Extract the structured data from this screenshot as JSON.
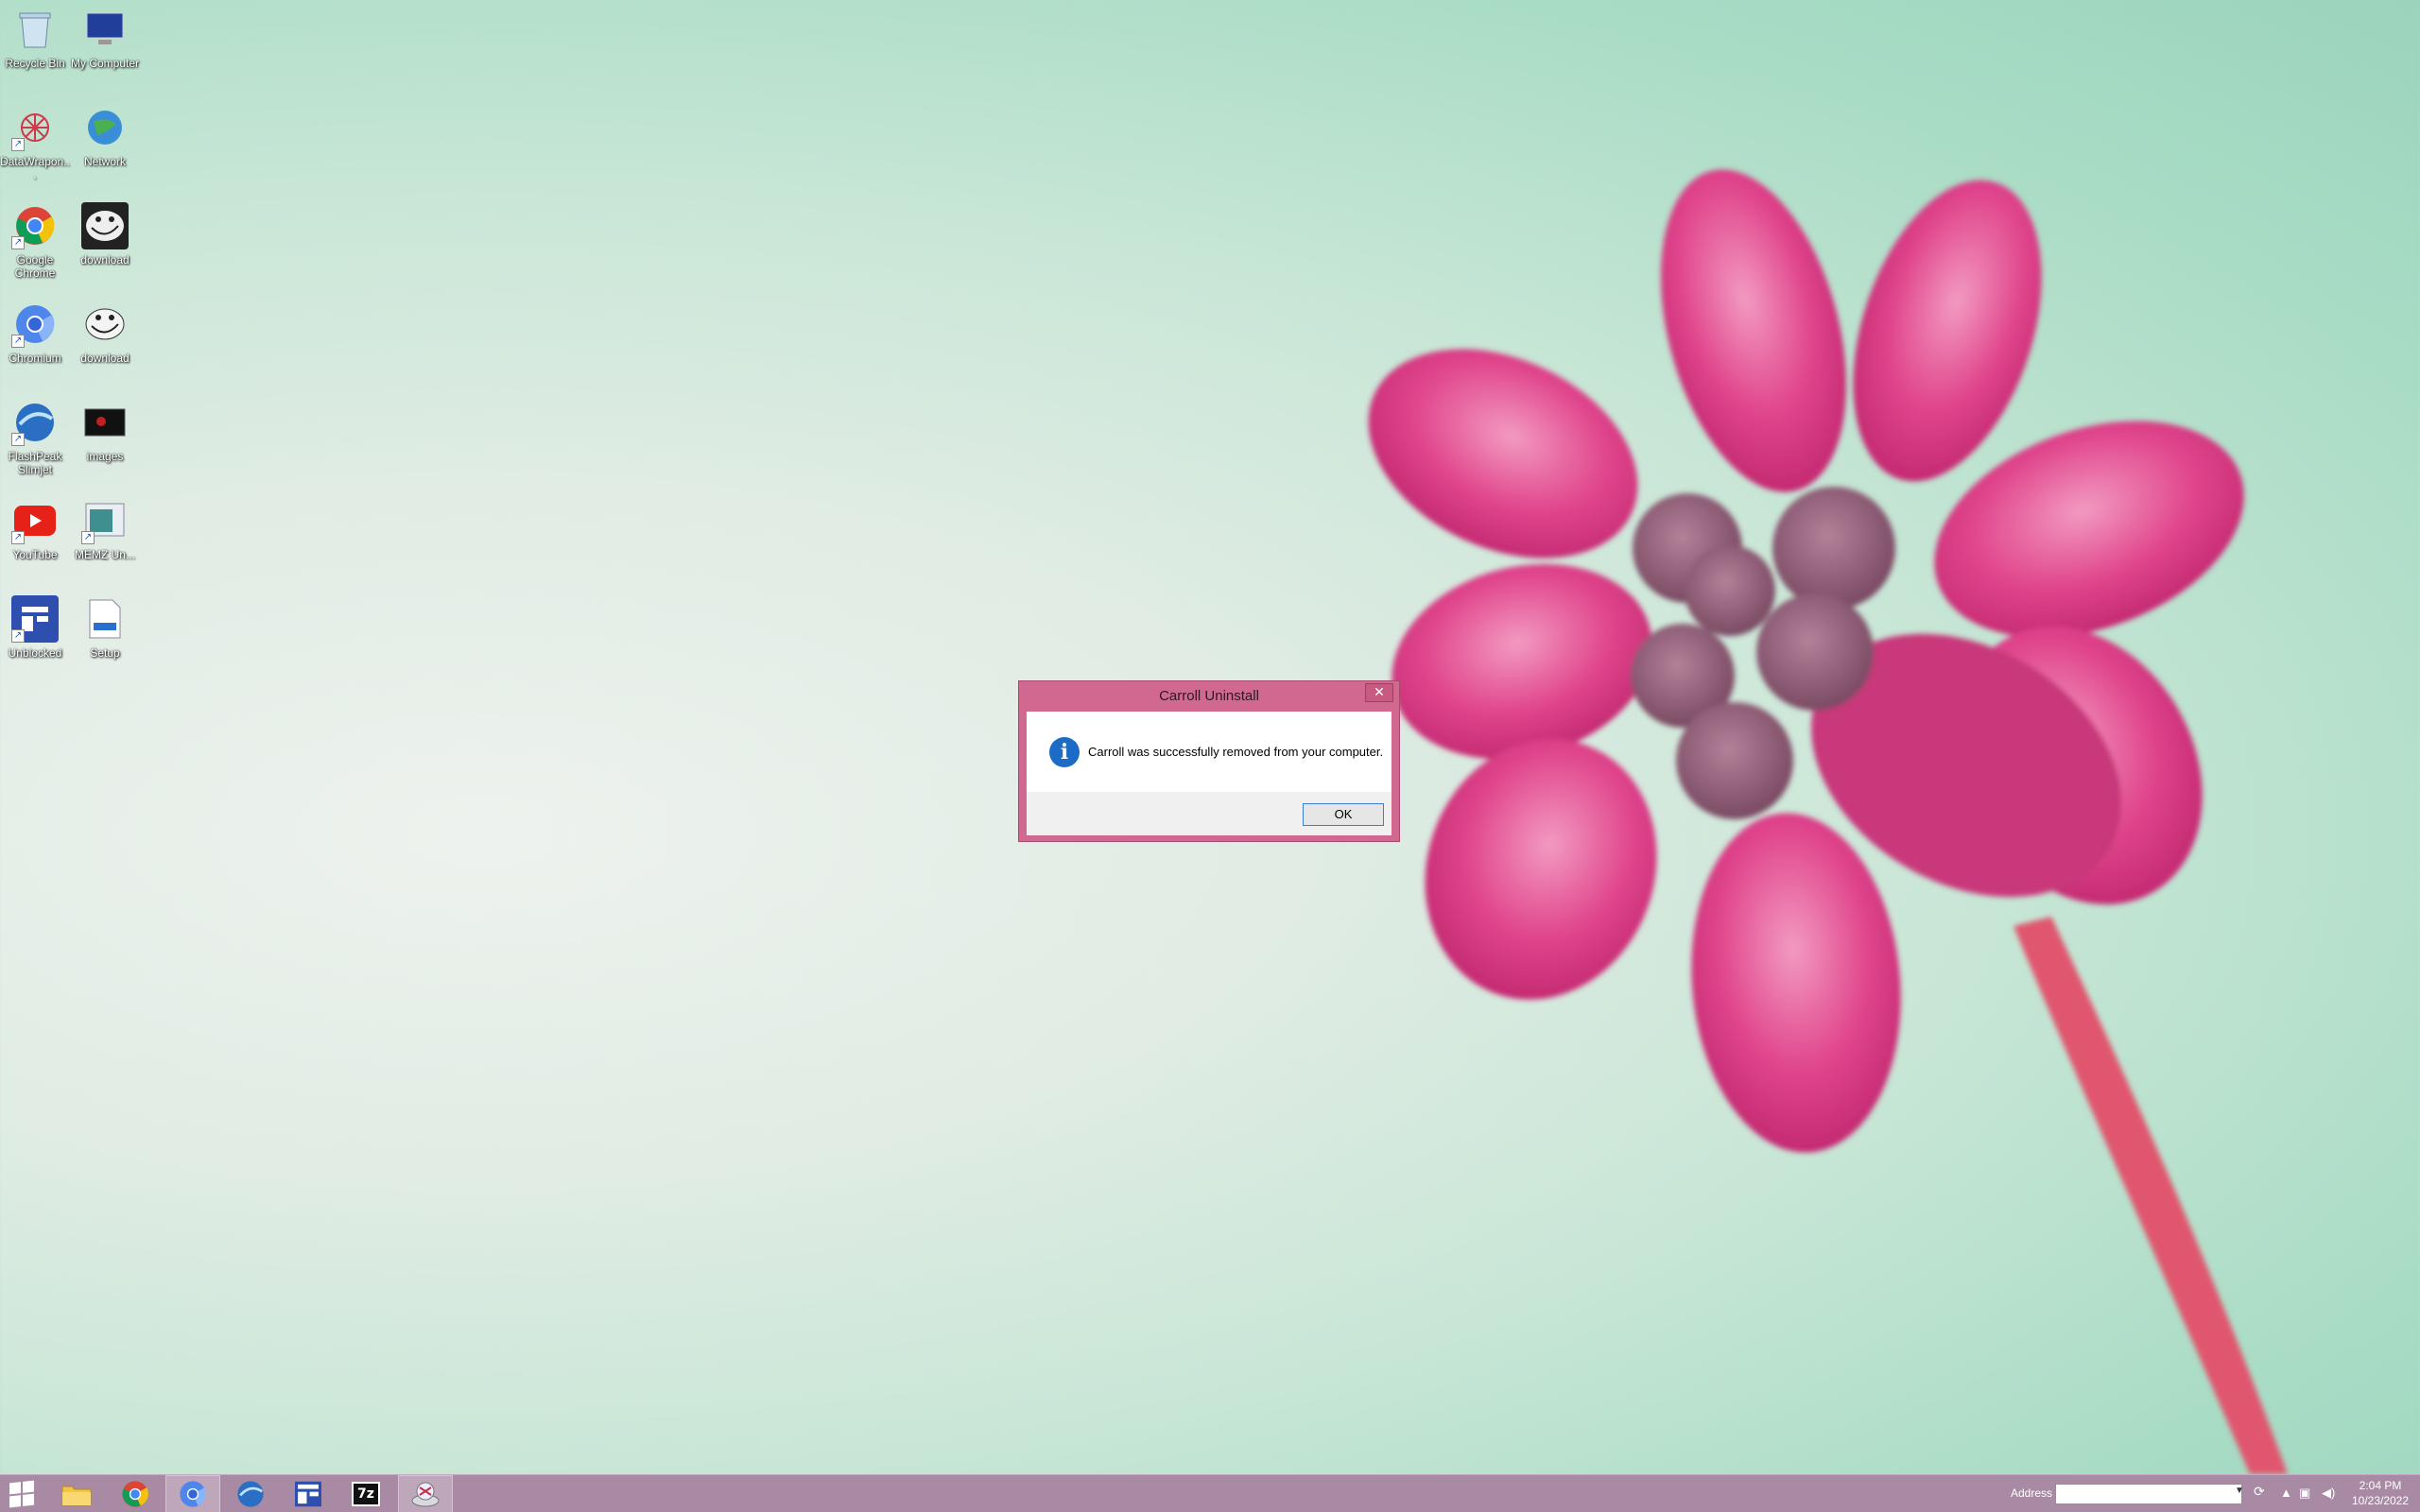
{
  "desktop": {
    "icons": [
      {
        "label": "Recycle Bin",
        "icon": "recycle-bin-icon"
      },
      {
        "label": "My Computer",
        "icon": "my-computer-icon"
      },
      {
        "label": "DataWrapon...",
        "icon": "datawrapper-icon"
      },
      {
        "label": "Network",
        "icon": "network-icon"
      },
      {
        "label": "Google Chrome",
        "icon": "chrome-icon"
      },
      {
        "label": "download",
        "icon": "troll-face-icon"
      },
      {
        "label": "Chromium",
        "icon": "chromium-icon"
      },
      {
        "label": "download",
        "icon": "troll-face-icon"
      },
      {
        "label": "FlashPeak Slimjet",
        "icon": "slimjet-icon"
      },
      {
        "label": "images",
        "icon": "image-file-icon"
      },
      {
        "label": "YouTube",
        "icon": "youtube-icon"
      },
      {
        "label": "MEMZ Un...",
        "icon": "memz-icon"
      },
      {
        "label": "Unblocked",
        "icon": "unblocked-icon"
      },
      {
        "label": "Setup",
        "icon": "setup-icon"
      }
    ]
  },
  "dialog": {
    "title": "Carroll Uninstall",
    "close_glyph": "✕",
    "message": "Carroll was successfully removed from your computer.",
    "info_glyph": "i",
    "ok_label": "OK"
  },
  "taskbar": {
    "address_label": "Address",
    "address_value": "",
    "clock_time": "2:04 PM",
    "clock_date": "10/23/2022",
    "pinned": [
      "start-icon",
      "file-explorer-icon",
      "chrome-icon",
      "chromium-icon",
      "slimjet-icon",
      "unblocked-icon",
      "7zip-icon",
      "uninstaller-icon"
    ],
    "seven_zip_text": "7z"
  },
  "colors": {
    "taskbar": "#a88aa4",
    "dialog_frame": "#d1688f",
    "accent": "#1c6bc7"
  }
}
